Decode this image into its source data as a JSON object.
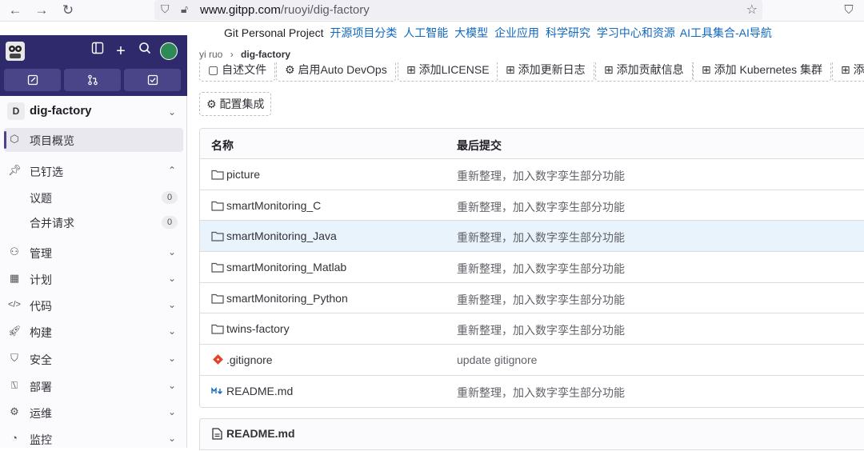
{
  "browser": {
    "url_domain": "www.gitpp.com",
    "url_path": "/ruoyi/dig-factory"
  },
  "banner": {
    "project": "Git Personal Project",
    "links": [
      "开源项目分类",
      "人工智能",
      "大模型",
      "企业应用",
      "科学研究",
      "学习中心和资源",
      "AI工具集合-AI导航"
    ]
  },
  "sidebar": {
    "project_letter": "D",
    "project_name": "dig-factory",
    "overview": "项目概览",
    "pinned": "已钉选",
    "issues": "议题",
    "issues_count": "0",
    "merge_requests": "合并请求",
    "mr_count": "0",
    "manage": "管理",
    "plan": "计划",
    "code": "代码",
    "build": "构建",
    "secure": "安全",
    "deploy": "部署",
    "operate": "运维",
    "monitor": "监控"
  },
  "breadcrumb": {
    "owner": "yi ruo",
    "separator": "›",
    "repo": "dig-factory"
  },
  "actions": {
    "readme": "自述文件",
    "autodevops": "启用Auto DevOps",
    "license": "添加LICENSE",
    "changelog": "添加更新日志",
    "contrib": "添加贡献信息",
    "k8s": "添加 Kubernetes 集群",
    "more": "添",
    "integrations": "配置集成"
  },
  "table": {
    "col_name": "名称",
    "col_commit": "最后提交",
    "rows": [
      {
        "name": "picture",
        "commit": "重新整理，加入数字孪生部分功能"
      },
      {
        "name": "smartMonitoring_C",
        "commit": "重新整理，加入数字孪生部分功能"
      },
      {
        "name": "smartMonitoring_Java",
        "commit": "重新整理，加入数字孪生部分功能"
      },
      {
        "name": "smartMonitoring_Matlab",
        "commit": "重新整理，加入数字孪生部分功能"
      },
      {
        "name": "smartMonitoring_Python",
        "commit": "重新整理，加入数字孪生部分功能"
      },
      {
        "name": "twins-factory",
        "commit": "重新整理，加入数字孪生部分功能"
      },
      {
        "name": ".gitignore",
        "commit": "update gitignore"
      },
      {
        "name": "README.md",
        "commit": "重新整理，加入数字孪生部分功能"
      }
    ]
  },
  "readme_title": "README.md",
  "colors": {
    "sidebar_top": "#2f2a6b",
    "link": "#1068bf",
    "highlight_row": "#e9f3fc"
  }
}
